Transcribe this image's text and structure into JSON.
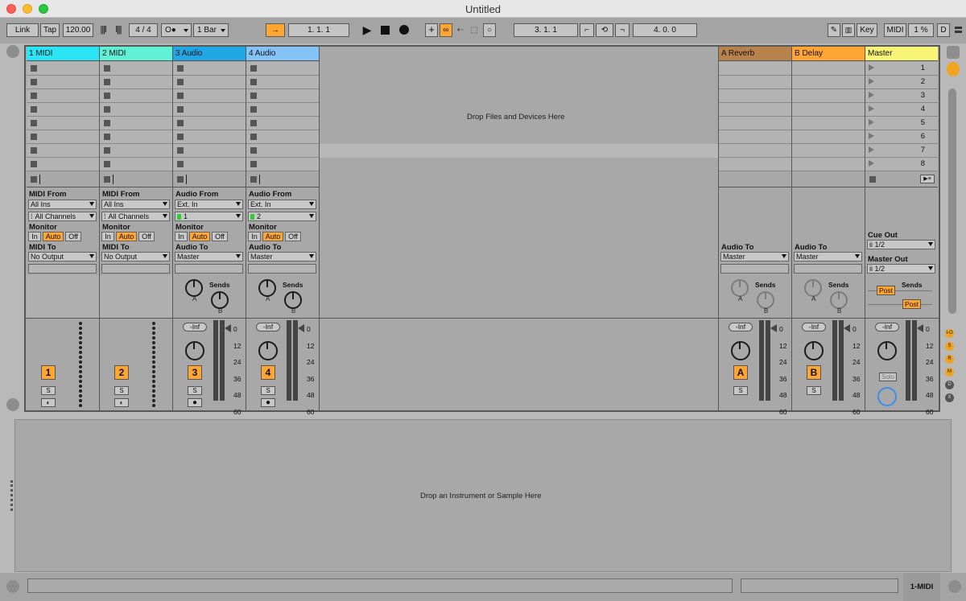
{
  "window": {
    "title": "Untitled"
  },
  "controlbar": {
    "link": "Link",
    "tap": "Tap",
    "tempo": "120.00",
    "sig": "4 / 4",
    "record_mode": "O●",
    "quantize": "1 Bar",
    "position": "1.   1.   1",
    "loop_start": "3.   1.   1",
    "loop_length": "4.   0.   0",
    "key": "Key",
    "midi": "MIDI",
    "cpu": "1 %",
    "disk": "D"
  },
  "tracks": [
    {
      "name": "1 MIDI",
      "color": "#29e5f6",
      "type": "midi",
      "in_label": "MIDI From",
      "in_src": "All Ins",
      "in_ch": "All Channels",
      "monitor": "Monitor",
      "mon_in": "In",
      "mon_auto": "Auto",
      "mon_off": "Off",
      "out_label": "MIDI To",
      "out_dest": "No Output",
      "num": "1",
      "solo": "S"
    },
    {
      "name": "2 MIDI",
      "color": "#5ff0d6",
      "type": "midi",
      "in_label": "MIDI From",
      "in_src": "All Ins",
      "in_ch": "All Channels",
      "monitor": "Monitor",
      "mon_in": "In",
      "mon_auto": "Auto",
      "mon_off": "Off",
      "out_label": "MIDI To",
      "out_dest": "No Output",
      "num": "2",
      "solo": "S"
    },
    {
      "name": "3 Audio",
      "color": "#1fa7e6",
      "type": "audio",
      "in_label": "Audio From",
      "in_src": "Ext. In",
      "in_ch": "1",
      "monitor": "Monitor",
      "mon_in": "In",
      "mon_auto": "Auto",
      "mon_off": "Off",
      "out_label": "Audio To",
      "out_dest": "Master",
      "num": "3",
      "solo": "S",
      "sends": "Sends",
      "vol": "-Inf"
    },
    {
      "name": "4 Audio",
      "color": "#85c3f7",
      "type": "audio",
      "in_label": "Audio From",
      "in_src": "Ext. In",
      "in_ch": "2",
      "monitor": "Monitor",
      "mon_in": "In",
      "mon_auto": "Auto",
      "mon_off": "Off",
      "out_label": "Audio To",
      "out_dest": "Master",
      "num": "4",
      "solo": "S",
      "sends": "Sends",
      "vol": "-Inf"
    }
  ],
  "returns": [
    {
      "name": "A Reverb",
      "color": "#b8824c",
      "out_label": "Audio To",
      "out_dest": "Master",
      "sends": "Sends",
      "vol": "-Inf",
      "letter": "A",
      "solo": "S"
    },
    {
      "name": "B Delay",
      "color": "#ffa533",
      "out_label": "Audio To",
      "out_dest": "Master",
      "sends": "Sends",
      "vol": "-Inf",
      "letter": "B",
      "solo": "S"
    }
  ],
  "master": {
    "name": "Master",
    "color": "#f7f476",
    "scenes": [
      "1",
      "2",
      "3",
      "4",
      "5",
      "6",
      "7",
      "8"
    ],
    "cue_label": "Cue Out",
    "cue_dest": "ii 1/2",
    "master_label": "Master Out",
    "master_dest": "ii 1/2",
    "sends": "Sends",
    "post1": "Post",
    "post2": "Post",
    "vol": "-Inf",
    "solo": "Solo"
  },
  "knob_labels": {
    "a": "A",
    "b": "B"
  },
  "meter_ticks": [
    "0",
    "12",
    "24",
    "36",
    "48",
    "60"
  ],
  "side_buttons": [
    "I-O",
    "S",
    "R",
    "M",
    "D",
    "X"
  ],
  "messages": {
    "drop_files": "Drop Files and Devices Here",
    "drop_instrument": "Drop an Instrument or Sample Here"
  },
  "status": {
    "track": "1-MIDI"
  }
}
